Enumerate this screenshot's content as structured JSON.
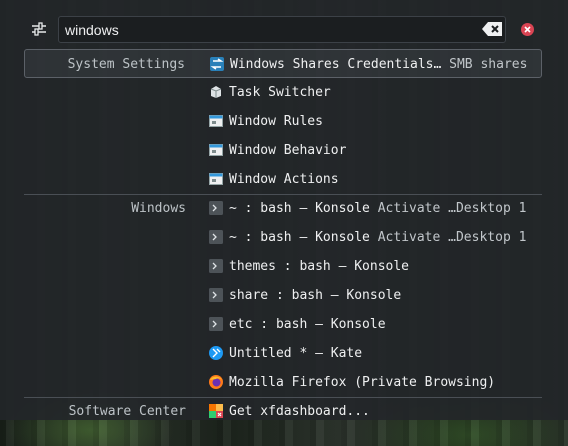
{
  "search": {
    "value": "windows"
  },
  "results": [
    {
      "category": "System Settings",
      "icon": "windows-shares-icon",
      "text": "Windows Shares Credentials…",
      "subtext": "SMB shares",
      "selected": true
    },
    {
      "category": "",
      "icon": "task-switcher-icon",
      "text": "Task Switcher",
      "subtext": ""
    },
    {
      "category": "",
      "icon": "window-rules-icon",
      "text": "Window Rules",
      "subtext": ""
    },
    {
      "category": "",
      "icon": "window-behavior-icon",
      "text": "Window Behavior",
      "subtext": ""
    },
    {
      "category": "",
      "icon": "window-actions-icon",
      "text": "Window Actions",
      "subtext": ""
    },
    {
      "category": "Windows",
      "icon": "konsole-icon",
      "text": "~ : bash — Konsole",
      "subtext": "Activate …Desktop 1"
    },
    {
      "category": "",
      "icon": "konsole-icon",
      "text": "~ : bash — Konsole",
      "subtext": "Activate …Desktop 1"
    },
    {
      "category": "",
      "icon": "konsole-icon",
      "text": "themes : bash — Konsole",
      "subtext": ""
    },
    {
      "category": "",
      "icon": "konsole-icon",
      "text": "share : bash — Konsole",
      "subtext": ""
    },
    {
      "category": "",
      "icon": "konsole-icon",
      "text": "etc : bash — Konsole",
      "subtext": ""
    },
    {
      "category": "",
      "icon": "kate-icon",
      "text": "Untitled * — Kate",
      "subtext": ""
    },
    {
      "category": "",
      "icon": "firefox-icon",
      "text": "Mozilla Firefox (Private Browsing)",
      "subtext": ""
    },
    {
      "category": "Software Center",
      "icon": "software-center-icon",
      "text": "Get xfdashboard...",
      "subtext": ""
    }
  ],
  "colors": {
    "panel": "#232629",
    "accent_close": "#da4453",
    "selection_border": "#5c6168"
  }
}
